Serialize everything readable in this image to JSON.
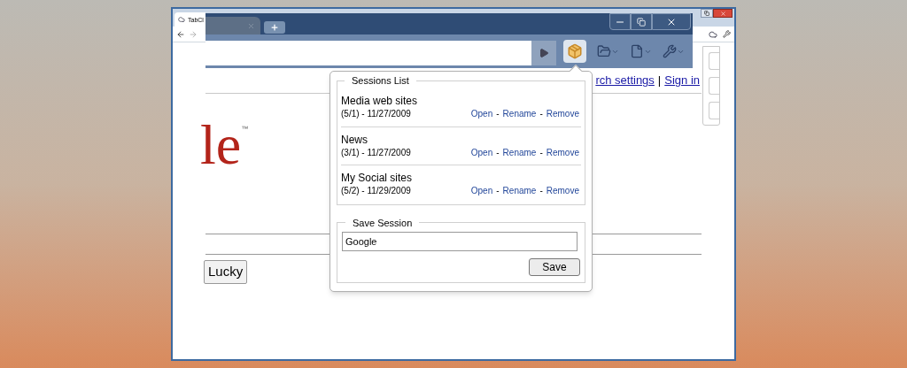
{
  "outer_window": {
    "tab_title": "TabCl"
  },
  "toolbar": {
    "extension_active": true
  },
  "page": {
    "logo": "le",
    "logo_mark": "™",
    "links": [
      "rch settings",
      "Sign in"
    ],
    "link_separator": "|",
    "button": "Lucky"
  },
  "popup": {
    "sessions_legend": "Sessions List",
    "action_separator": "-",
    "sessions": [
      {
        "name": "Media web sites",
        "info": "(5/1) - 11/27/2009",
        "actions": [
          "Open",
          "Rename",
          "Remove"
        ]
      },
      {
        "name": "News",
        "info": "(3/1) - 11/27/2009",
        "actions": [
          "Open",
          "Rename",
          "Remove"
        ]
      },
      {
        "name": "My Social sites",
        "info": "(5/2) - 11/29/2009",
        "actions": [
          "Open",
          "Rename",
          "Remove"
        ]
      }
    ],
    "save_legend": "Save Session",
    "save_value": "Google",
    "save_button": "Save"
  }
}
